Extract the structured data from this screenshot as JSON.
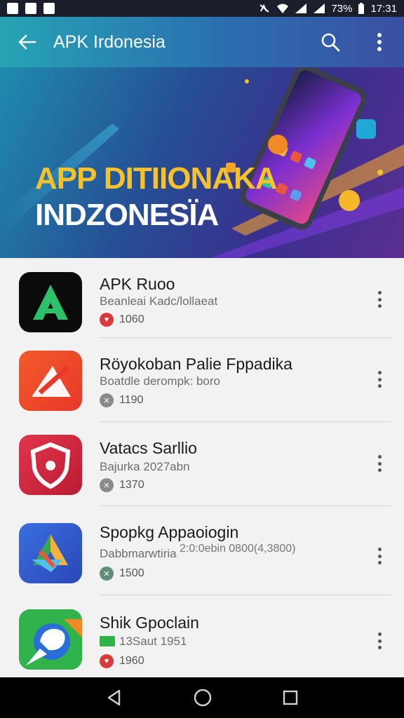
{
  "status_bar": {
    "battery": "7̈3%",
    "time": "17:31"
  },
  "appbar": {
    "title": "APK Irdonesia"
  },
  "banner": {
    "line1": "APP DITIIONAKA",
    "line2": "INDZONESÏA"
  },
  "apps": [
    {
      "name": "APK Ruoo",
      "subtitle": "Beanleai Kadc/lollaeat",
      "count": "1060",
      "badge_color": "#d93a3a"
    },
    {
      "name": "Röyokoban Palie Fppadika",
      "subtitle": "Boatdle derompk: boro",
      "count": "1190",
      "badge_color": "#8a8a8a"
    },
    {
      "name": "Vatacs Sarllio",
      "subtitle": "Bajurka 2027abn",
      "count": "1370",
      "badge_color": "#8a8a8a"
    },
    {
      "name": "Spopkg Appaoiogin",
      "subtitle": "Dabbmarwtiria",
      "extra": "2:0:0ebin 0800(4,3800)",
      "count": "1500",
      "badge_color": "#5f8f79"
    },
    {
      "name": "Shik Gpoclain",
      "subtitle": "13Saut 1951",
      "count": "1960",
      "badge_color": "#d93a3a"
    }
  ],
  "colors": {
    "appbar_start": "#27a3b4",
    "appbar_end": "#3b4fa3",
    "banner_yellow": "#f5c22b"
  }
}
